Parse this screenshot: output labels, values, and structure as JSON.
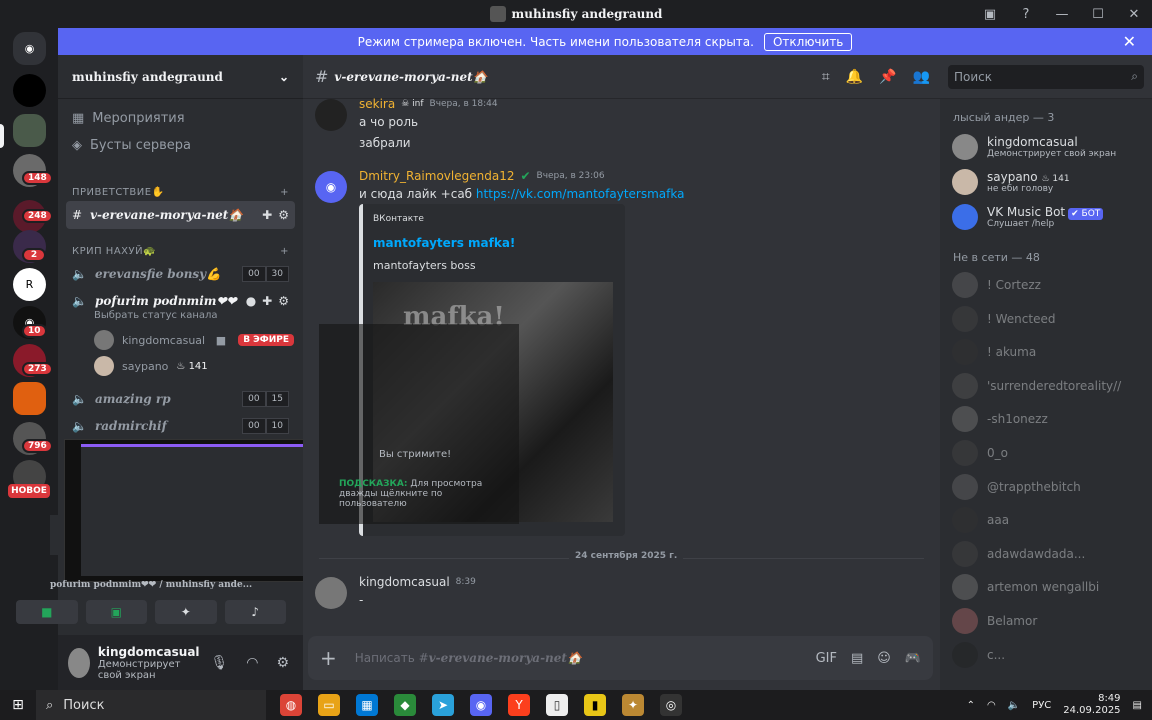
{
  "window": {
    "title": "muhinsfiy andegraund"
  },
  "banner": {
    "text": "Режим стримера включен. Часть имени пользователя скрыта.",
    "button": "Отключить"
  },
  "server": {
    "name": "muhinsfiy andegraund"
  },
  "nav": {
    "events": "Мероприятия",
    "boosts": "Бусты сервера"
  },
  "categories": {
    "c1": "ПРИВЕТСТВИЕ✋",
    "c2": "КРИП НАХУЙ🐢"
  },
  "channels": {
    "text1": "v-erevane-morya-net🏠",
    "v1": {
      "name": "erevansfie bonsy💪",
      "a": "00",
      "b": "30"
    },
    "v2": {
      "name": "pofurim podnmim❤❤",
      "status": "Выбрать статус канала"
    },
    "v3": {
      "name": "amazing rp",
      "a": "00",
      "b": "15"
    },
    "v4": {
      "name": "radmirchif",
      "a": "00",
      "b": "10"
    }
  },
  "voice_users": [
    {
      "name": "kingdomcasual",
      "badge": "В ЭФИРЕ"
    },
    {
      "name": "saypano",
      "count": "141"
    }
  ],
  "voice_panel": {
    "line1": "pofurim podnmim❤❤ / muhinsfiy ande..."
  },
  "user": {
    "name": "kingdomcasual",
    "status": "Демонстрирует свой экран"
  },
  "channel_header": {
    "name": "v-erevane-morya-net🏠"
  },
  "search": {
    "placeholder": "Поиск"
  },
  "messages": [
    {
      "author": "sekira",
      "tag": "inf",
      "time": "Вчера, в 18:44",
      "lines": [
        "а чо роль",
        "забрали"
      ]
    },
    {
      "author": "Dmitry_Raimovlegenda12",
      "time": "Вчера, в 23:06",
      "text": "и сюда лайк +саб ",
      "link": "https://vk.com/mantofaytersmafka"
    },
    {
      "author": "kingdomcasual",
      "time": "8:39",
      "text": "-"
    }
  ],
  "embed": {
    "provider": "ВКонтакте",
    "title": "mantofayters mafka!",
    "desc": "mantofayters boss",
    "img_text": "mafka!",
    "stream_text": "Вы стримите!",
    "hint_label": "ПОДСКАЗКА:",
    "hint": "Для просмотра дважды щёлкните по пользователю"
  },
  "date_divider": "24 сентября 2025 г.",
  "input": {
    "placeholder_prefix": "Написать #",
    "placeholder_channel": "v-erevane-morya-net🏠"
  },
  "members": {
    "cat1": "лысый андер — 3",
    "online": [
      {
        "name": "kingdomcasual",
        "sub": "Демонстрирует свой экран"
      },
      {
        "name": "saypano",
        "count": "141",
        "sub": "не еби голову"
      },
      {
        "name": "VK Music Bot",
        "tag": "✔ БОТ",
        "sub": "Слушает /help"
      }
    ],
    "cat2": "Не в сети — 48",
    "offline": [
      "! Cortezz",
      "! Wencteed",
      "! akuma",
      "'surrenderedtoreality//",
      "-sh1onezz",
      "0_o",
      "@trappthebitch",
      "aaa",
      "adawdawdada...",
      "artemon wengallbi",
      "Belamor",
      "c..."
    ]
  },
  "guild_badges": [
    "148",
    "248",
    "2",
    "10",
    "273",
    "796"
  ],
  "guild_new": "НОВОЕ",
  "taskbar": {
    "search": "Поиск",
    "lang": "РУС",
    "time": "8:49",
    "date": "24.09.2025"
  },
  "colors": {
    "accent": "#5865f2",
    "live": "#da373c",
    "author1": "#f0b232",
    "author2": "#f0b232",
    "link": "#00a8fc"
  }
}
